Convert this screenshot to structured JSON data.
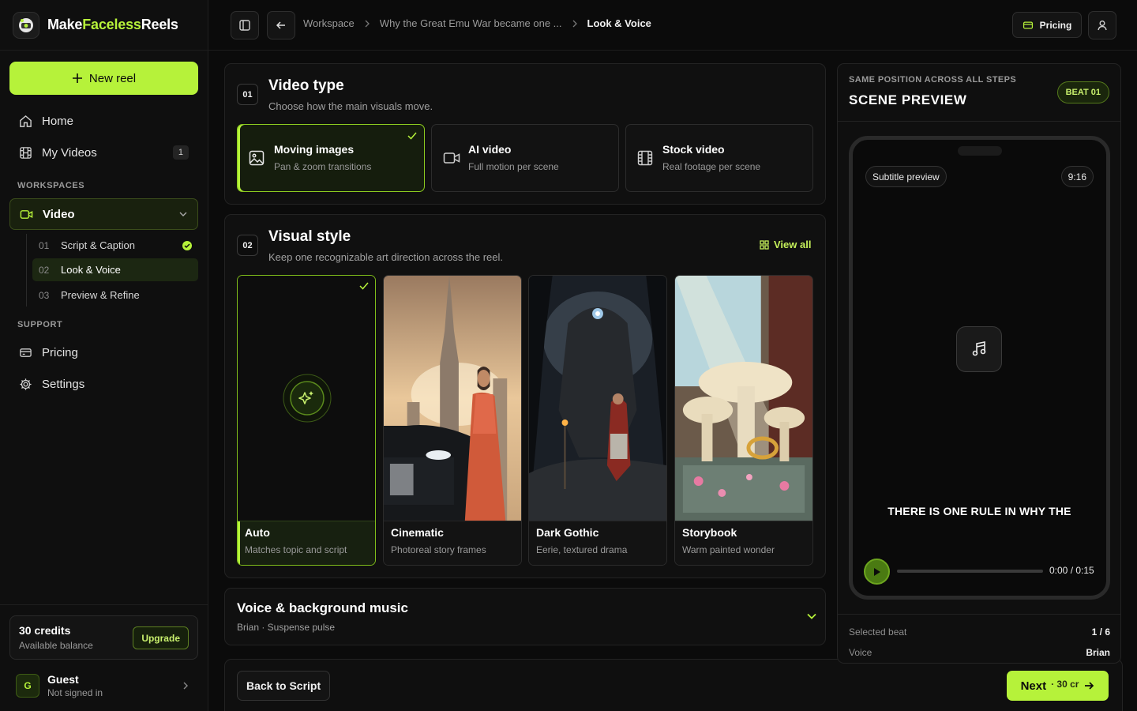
{
  "brand": {
    "name_part1": "Make",
    "name_part2": "Faceless",
    "name_part3": "Reels"
  },
  "sidebar": {
    "new_reel_label": "New reel",
    "nav": [
      {
        "label": "Home",
        "icon": "home-icon"
      },
      {
        "label": "My Videos",
        "icon": "film-icon",
        "badge": "1"
      }
    ],
    "workspaces_label": "WORKSPACES",
    "video_label": "Video",
    "steps": [
      {
        "num": "01",
        "label": "Script & Caption",
        "done": true
      },
      {
        "num": "02",
        "label": "Look & Voice",
        "active": true
      },
      {
        "num": "03",
        "label": "Preview & Refine"
      }
    ],
    "support_label": "SUPPORT",
    "support": [
      {
        "label": "Pricing",
        "icon": "card-icon"
      },
      {
        "label": "Settings",
        "icon": "gear-icon"
      }
    ],
    "credits": {
      "title": "30 credits",
      "sub": "Available balance",
      "upgrade": "Upgrade"
    },
    "guest": {
      "initial": "G",
      "name": "Guest",
      "sub": "Not signed in"
    }
  },
  "topbar": {
    "breadcrumbs": [
      "Workspace",
      "Why the Great Emu War became one ...",
      "Look & Voice"
    ],
    "pricing_label": "Pricing"
  },
  "video_type": {
    "step": "01",
    "title": "Video type",
    "sub": "Choose how the main visuals move.",
    "options": [
      {
        "title": "Moving images",
        "sub": "Pan & zoom transitions",
        "selected": true,
        "icon": "image-icon"
      },
      {
        "title": "AI video",
        "sub": "Full motion per scene",
        "icon": "video-camera-icon"
      },
      {
        "title": "Stock video",
        "sub": "Real footage per scene",
        "icon": "film-strip-icon"
      }
    ]
  },
  "visual_style": {
    "step": "02",
    "title": "Visual style",
    "sub": "Keep one recognizable art direction across the reel.",
    "view_all": "View all",
    "styles": [
      {
        "name": "Auto",
        "desc": "Matches topic and script",
        "selected": true
      },
      {
        "name": "Cinematic",
        "desc": "Photoreal story frames"
      },
      {
        "name": "Dark Gothic",
        "desc": "Eerie, textured drama"
      },
      {
        "name": "Storybook",
        "desc": "Warm painted wonder"
      }
    ]
  },
  "voice": {
    "title": "Voice & background music",
    "sub": "Brian · Suspense pulse"
  },
  "footer": {
    "back": "Back to Script",
    "next": "Next",
    "cost": "· 30 cr"
  },
  "preview": {
    "eyebrow": "SAME POSITION ACROSS ALL STEPS",
    "title": "SCENE PREVIEW",
    "beat": "BEAT 01",
    "subtitle_chip": "Subtitle preview",
    "ratio_chip": "9:16",
    "caption": "THERE IS ONE RULE IN WHY THE",
    "time": "0:00 / 0:15",
    "progress": 0,
    "meta": [
      {
        "k": "Selected beat",
        "v": "1 / 6"
      },
      {
        "k": "Voice",
        "v": "Brian"
      }
    ]
  }
}
